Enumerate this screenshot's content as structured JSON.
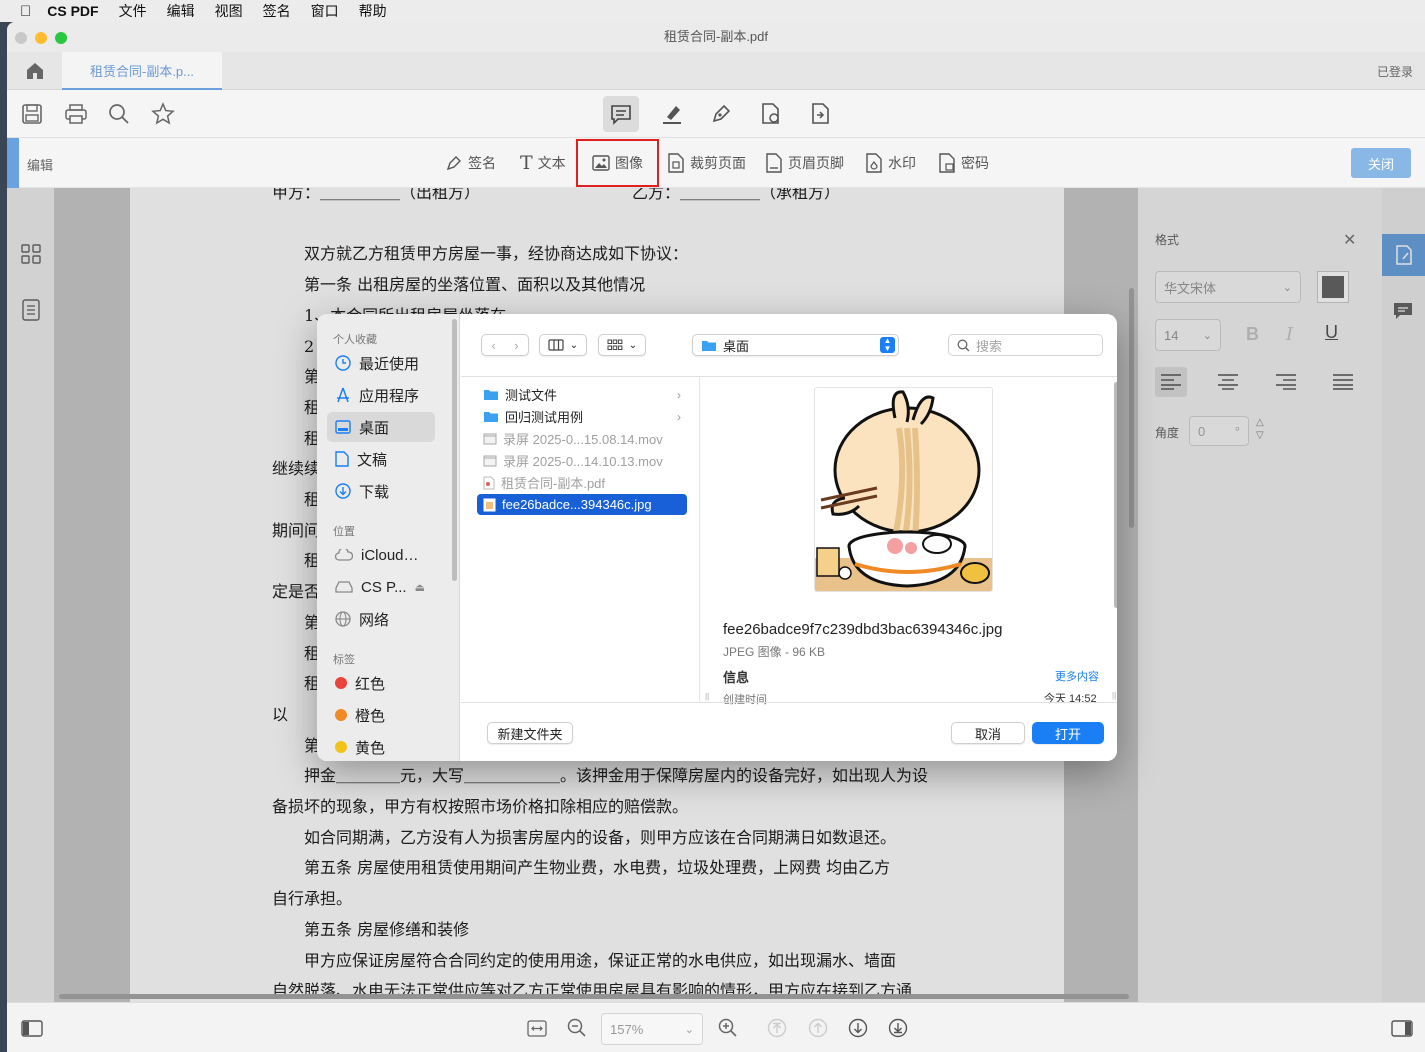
{
  "menubar": {
    "app": "CS PDF",
    "items": [
      "文件",
      "编辑",
      "视图",
      "签名",
      "窗口",
      "帮助"
    ]
  },
  "window": {
    "title": "租赁合同-副本.pdf"
  },
  "tabs": {
    "active_tab": "租赁合同-副本.p...",
    "login_status": "已登录"
  },
  "editbar": {
    "label": "编辑",
    "tools": [
      "签名",
      "文本",
      "图像",
      "裁剪页面",
      "页眉页脚",
      "水印",
      "密码"
    ],
    "close": "关闭"
  },
  "document": {
    "lines": [
      "甲方：＿＿＿＿＿（出租方）　　　　　　　　　　乙方：＿＿＿＿＿（承租方）",
      "",
      "　　双方就乙方租赁甲方房屋一事，经协商达成如下协议：",
      "　　第一条  出租房屋的坐落位置、面积以及其他情况",
      "　　1、本合同所出租房屋坐落在",
      "　　2",
      "　　第",
      "　　租",
      "　　租",
      "继续续",
      "　　租",
      "期间间",
      "　　租",
      "定是否",
      "　　第",
      "　　租",
      "　　租",
      "以",
      "　　第",
      "　　押金＿＿＿＿元，大写＿＿＿＿＿＿。该押金用于保障房屋内的设备完好，如出现人为设",
      "备损坏的现象，甲方有权按照市场价格扣除相应的赔偿款。",
      "　　如合同期满，乙方没有人为损害房屋内的设备，则甲方应该在合同期满日如数退还。",
      "　　第五条  房屋使用租赁使用期间产生物业费，水电费，垃圾处理费，上网费 均由乙方",
      "自行承担。",
      "　　第五条  房屋修缮和装修",
      "　　甲方应保证房屋符合合同约定的使用用途，保证正常的水电供应，如出现漏水、墙面",
      "自然脱落、水电无法正常供应等对乙方正常使用房屋具有影响的情形，甲方应在接到乙方通"
    ]
  },
  "format_panel": {
    "title": "格式",
    "font": "华文宋体",
    "size": "14",
    "angle_label": "角度",
    "angle_value": "0",
    "angle_unit": "°"
  },
  "bottombar": {
    "zoom": "157%"
  },
  "dialog": {
    "sidebar": {
      "favorites_header": "个人收藏",
      "favorites": [
        "最近使用",
        "应用程序",
        "桌面",
        "文稿",
        "下载"
      ],
      "locations_header": "位置",
      "locations": [
        "iCloud…",
        "CS P...",
        "网络"
      ],
      "tags_header": "标签",
      "tags": [
        {
          "name": "红色",
          "color": "#e8443a"
        },
        {
          "name": "橙色",
          "color": "#f08a24"
        },
        {
          "name": "黄色",
          "color": "#f2c21b"
        }
      ]
    },
    "location": "桌面",
    "search_placeholder": "搜索",
    "files": [
      {
        "name": "测试文件",
        "type": "folder"
      },
      {
        "name": "回归测试用例",
        "type": "folder"
      },
      {
        "name": "录屏 2025-0...15.08.14.mov",
        "type": "movie"
      },
      {
        "name": "录屏 2025-0...14.10.13.mov",
        "type": "movie"
      },
      {
        "name": "租赁合同-副本.pdf",
        "type": "pdf"
      },
      {
        "name": "fee26badce...394346c.jpg",
        "type": "image"
      }
    ],
    "preview": {
      "filename": "fee26badce9f7c239dbd3bac6394346c.jpg",
      "kind": "JPEG 图像 - 96 KB",
      "info_label": "信息",
      "more": "更多内容",
      "created_label": "创建时间",
      "created_value": "今天 14:52"
    },
    "new_folder": "新建文件夹",
    "cancel": "取消",
    "open": "打开"
  },
  "colors": {
    "accent": "#1a7ff5",
    "selection": "#1860d8",
    "close_btn": "#8ab8e6",
    "highlight_box": "#e02020",
    "sidebar_accent": "#6aa2e0"
  }
}
